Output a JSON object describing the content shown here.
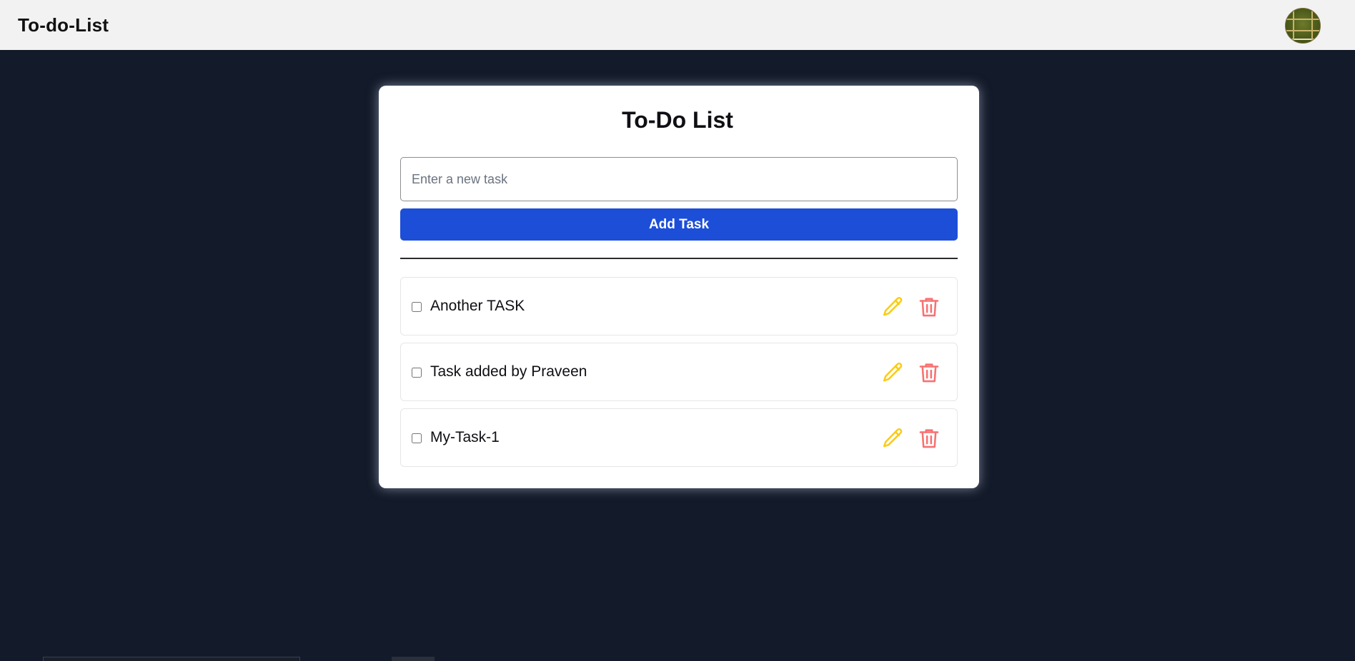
{
  "navbar": {
    "brand": "To-do-List",
    "avatar_icon": "avatar-image"
  },
  "card": {
    "title": "To-Do List",
    "input": {
      "value": "",
      "placeholder": "Enter a new task"
    },
    "add_button_label": "Add Task"
  },
  "tasks": [
    {
      "label": "Another TASK",
      "checked": false
    },
    {
      "label": "Task added by Praveen",
      "checked": false
    },
    {
      "label": "My-Task-1",
      "checked": false
    }
  ],
  "icons": {
    "edit": "pencil-icon",
    "delete": "trash-icon"
  },
  "colors": {
    "page_bg": "#131a29",
    "navbar_bg": "#f2f2f2",
    "accent": "#1d4ed8",
    "edit_icon": "#facc15",
    "delete_icon": "#f87171"
  }
}
